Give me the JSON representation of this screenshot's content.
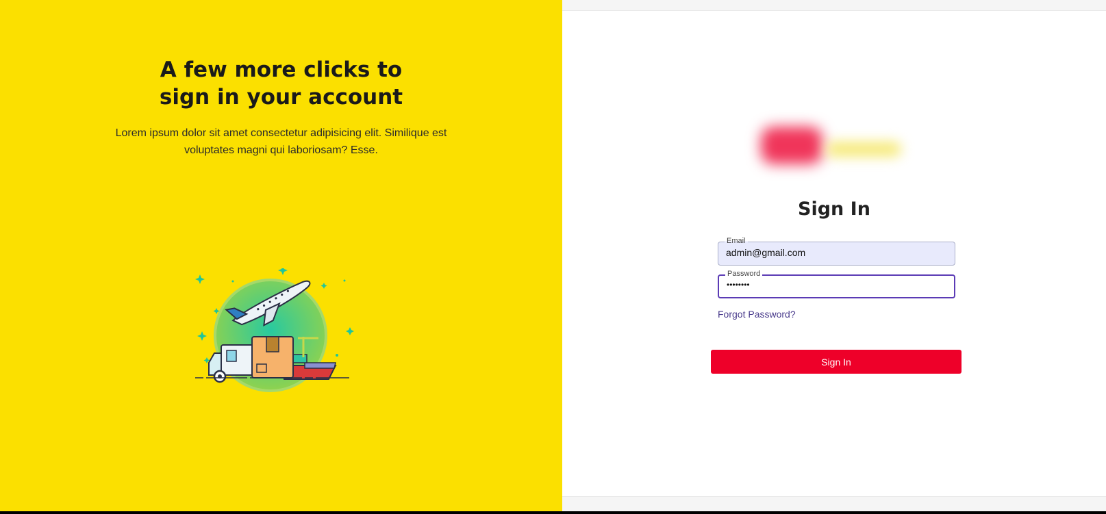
{
  "promo": {
    "headline_line1": "A few more clicks to",
    "headline_line2": "sign in your account",
    "description": "Lorem ipsum dolor sit amet consectetur adipisicing elit. Similique est voluptates magni qui laboriosam? Esse.",
    "illustration_icon": "delivery-transport-illustration"
  },
  "form": {
    "title": "Sign In",
    "email": {
      "label": "Email",
      "value": "admin@gmail.com"
    },
    "password": {
      "label": "Password",
      "value": "••••••••"
    },
    "forgot_link": "Forgot Password?",
    "submit_label": "Sign In"
  },
  "colors": {
    "promo_background": "#fbe000",
    "submit_background": "#ee0029",
    "focus_border": "#5b3bb5",
    "autofill_background": "#e8eafc"
  }
}
